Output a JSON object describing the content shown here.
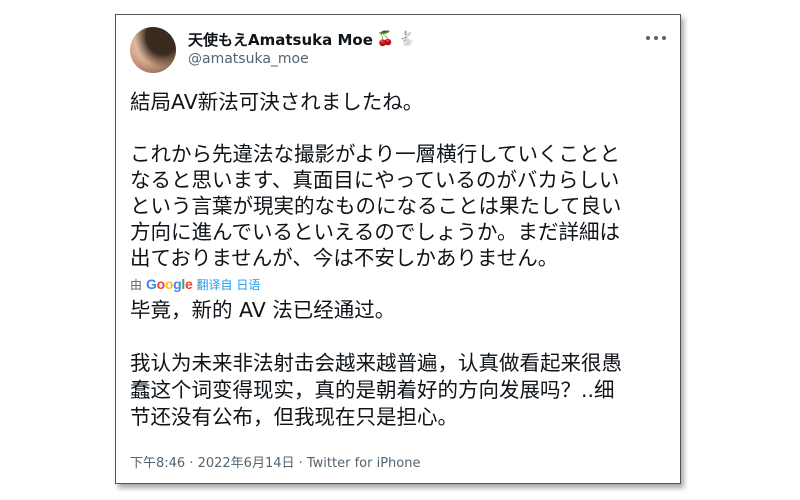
{
  "tweet": {
    "display_name": "天使もえAmatsuka Moe",
    "name_emojis": [
      "🍒",
      "🐇"
    ],
    "handle": "@amatsuka_moe",
    "original_lines": [
      "結局AV新法可決されましたね。",
      "",
      "これから先違法な撮影がより一層横行していくことと",
      "なると思います、真面目にやっているのがバカらしい",
      "という言葉が現実的なものになることは果たして良い",
      "方向に進んでいるといえるのでしょうか。まだ詳細は",
      "出ておりませんが、今は不安しかありません。"
    ],
    "translation": {
      "prefix": "由",
      "provider": "Google",
      "link_text": "翻译自 日语",
      "lines": [
        "毕竟，新的 AV 法已经通过。",
        "",
        "我认为未来非法射击会越来越普遍，认真做看起来很愚",
        "蠢这个词变得现实，真的是朝着好的方向发展吗？..细",
        "节还没有公布，但我现在只是担心。"
      ]
    },
    "meta": "下午8:46 · 2022年6月14日 · Twitter for iPhone"
  },
  "colors": {
    "text": "#0f1419",
    "secondary": "#536471",
    "link": "#1d9bf0"
  }
}
